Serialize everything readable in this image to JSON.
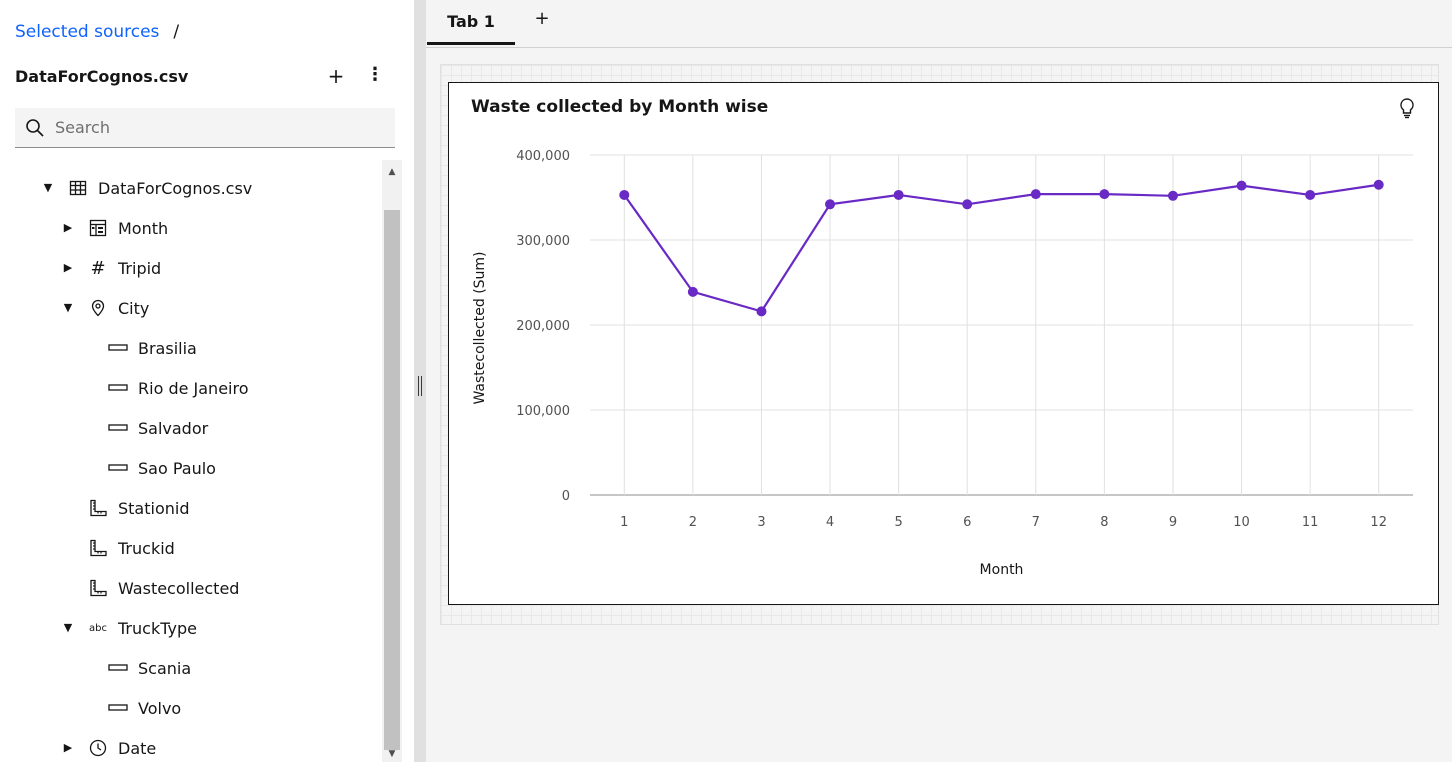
{
  "breadcrumb": {
    "link": "Selected sources",
    "separator": "/"
  },
  "source": {
    "name": "DataForCognos.csv",
    "add_label": "+",
    "more_label": "⋮"
  },
  "search": {
    "placeholder": "Search"
  },
  "tree": [
    {
      "label": "DataForCognos.csv",
      "level": 0,
      "caret": "down",
      "icon": "table-icon"
    },
    {
      "label": "Month",
      "level": 1,
      "caret": "right",
      "icon": "calendar-table-icon"
    },
    {
      "label": "Tripid",
      "level": 1,
      "caret": "right",
      "icon": "hash-icon"
    },
    {
      "label": "City",
      "level": 1,
      "caret": "down",
      "icon": "location-pin-icon"
    },
    {
      "label": "Brasilia",
      "level": 2,
      "caret": "",
      "icon": "member-icon"
    },
    {
      "label": "Rio de Janeiro",
      "level": 2,
      "caret": "",
      "icon": "member-icon"
    },
    {
      "label": "Salvador",
      "level": 2,
      "caret": "",
      "icon": "member-icon"
    },
    {
      "label": "Sao Paulo",
      "level": 2,
      "caret": "",
      "icon": "member-icon"
    },
    {
      "label": "Stationid",
      "level": 1,
      "caret": "",
      "icon": "measure-ruler-icon"
    },
    {
      "label": "Truckid",
      "level": 1,
      "caret": "",
      "icon": "measure-ruler-icon"
    },
    {
      "label": "Wastecollected",
      "level": 1,
      "caret": "",
      "icon": "measure-ruler-icon"
    },
    {
      "label": "TruckType",
      "level": 1,
      "caret": "down",
      "icon": "abc-icon"
    },
    {
      "label": "Scania",
      "level": 2,
      "caret": "",
      "icon": "member-icon"
    },
    {
      "label": "Volvo",
      "level": 2,
      "caret": "",
      "icon": "member-icon"
    },
    {
      "label": "Date",
      "level": 1,
      "caret": "right",
      "icon": "clock-icon"
    }
  ],
  "tabs": {
    "active_label": "Tab 1",
    "add_label": "+"
  },
  "widget": {
    "title": "Waste collected by Month wise"
  },
  "colors": {
    "series": "#6929c4",
    "link": "#0f62fe",
    "grid": "#e0e0e0"
  },
  "chart_data": {
    "type": "line",
    "title": "Waste collected by Month wise",
    "xlabel": "Month",
    "ylabel": "Wastecollected (Sum)",
    "categories": [
      "1",
      "2",
      "3",
      "4",
      "5",
      "6",
      "7",
      "8",
      "9",
      "10",
      "11",
      "12"
    ],
    "values": [
      353000,
      239000,
      216000,
      342000,
      353000,
      342000,
      354000,
      354000,
      352000,
      364000,
      353000,
      365000
    ],
    "ylim": [
      0,
      400000
    ],
    "yticks": [
      0,
      100000,
      200000,
      300000,
      400000
    ],
    "ytick_labels": [
      "0",
      "100,000",
      "200,000",
      "300,000",
      "400,000"
    ],
    "grid": true,
    "legend": "none"
  }
}
